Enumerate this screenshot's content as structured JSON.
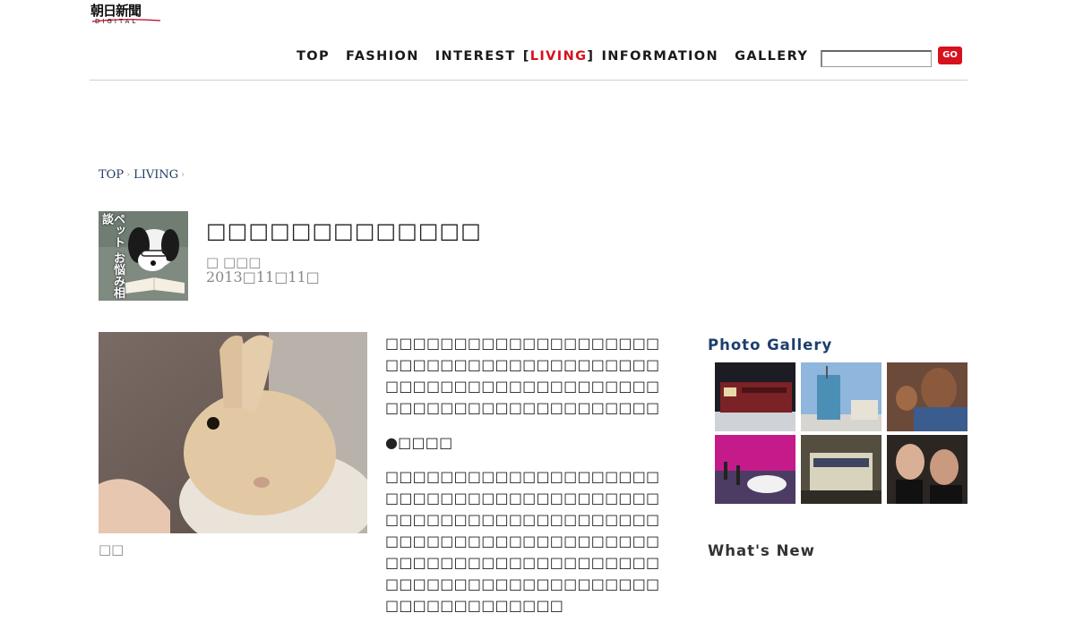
{
  "header": {
    "logo_text": "朝日新聞",
    "logo_sub": "DIGITAL",
    "nav": {
      "top": "TOP",
      "fashion": "FASHION",
      "interest": "INTEREST",
      "bracket_open": "[",
      "living": "LIVING",
      "bracket_close": "]",
      "information": "INFORMATION",
      "gallery": "GALLERY"
    },
    "search": {
      "value": "",
      "placeholder": ""
    },
    "go_label": "GO"
  },
  "breadcrumb": {
    "items": [
      "TOP",
      "LIVING"
    ]
  },
  "article_header": {
    "thumb_label": "ペット お悩み相談",
    "title": "□□□□□□□□□□□□□",
    "author": "□ □□□",
    "date": "2013□11□11□"
  },
  "photo": {
    "caption": "□□"
  },
  "article": {
    "paragraphs": [
      "□□□□□□□□□□□□□□□□□□□□□□□□□□□□□□□□□□□□□□□□□□□□□□□□□□□□□□□□□□□□□□□□□□□□□□□□□□□□□□□□",
      "●□□□□",
      "□□□□□□□□□□□□□□□□□□□□□□□□□□□□□□□□□□□□□□□□□□□□□□□□□□□□□□□□□□□□□□□□□□□□□□□□□□□□□□□□□□□□□□□□□□□□□□□□□□□□□□□□□□□□□□□□□□□□□□□□□□□□□□□□□□□□□"
    ]
  },
  "sidebar": {
    "photo_gallery_title": "Photo Gallery",
    "whats_new_title": "What's New",
    "gallery_items": [
      "train-night",
      "tower-construction",
      "children-portrait",
      "car-show",
      "train-station",
      "actors-portrait"
    ]
  },
  "colors": {
    "accent_red": "#d7111e",
    "link_navy": "#1d3f6e"
  }
}
